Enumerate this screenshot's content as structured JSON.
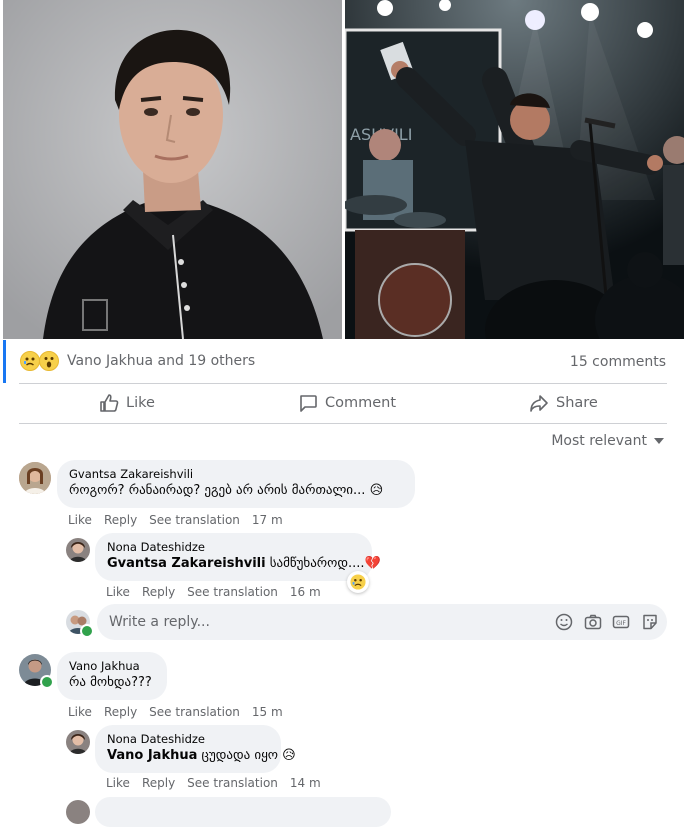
{
  "post": {
    "reactions": {
      "names": "Vano Jakhua and 19 others",
      "icons": [
        "sad-reaction",
        "wow-reaction"
      ]
    },
    "comment_count": "15 comments",
    "actions": {
      "like": "Like",
      "comment": "Comment",
      "share": "Share"
    },
    "sort_label": "Most relevant"
  },
  "comments": [
    {
      "author": "Gvantsa Zakareishvili",
      "text": "როგორ? რანაირად? ეგებ არ არის მართალი...",
      "like": "Like",
      "reply": "Reply",
      "translate": "See translation",
      "time": "17 m",
      "reply_comment": {
        "author": "Nona Dateshidze",
        "mention": "Gvantsa Zakareishvili",
        "text": "სამწუხაროდ....",
        "like": "Like",
        "reply": "Reply",
        "translate": "See translation",
        "time": "16 m"
      }
    },
    {
      "author": "Vano Jakhua",
      "text": "რა მოხდა???",
      "like": "Like",
      "reply": "Reply",
      "translate": "See translation",
      "time": "15 m",
      "reply_comment": {
        "author": "Nona Dateshidze",
        "mention": "Vano Jakhua",
        "text": "ცუდადა იყო",
        "like": "Like",
        "reply": "Reply",
        "translate": "See translation",
        "time": "14 m"
      }
    }
  ],
  "reply_box": {
    "placeholder": "Write a reply...",
    "tools": [
      "emoji-icon",
      "camera-icon",
      "gif-icon",
      "sticker-icon"
    ]
  },
  "colors": {
    "accent": "#1877f2",
    "bubble": "#f0f2f5",
    "meta_text": "#65676b",
    "online": "#31a24c"
  }
}
